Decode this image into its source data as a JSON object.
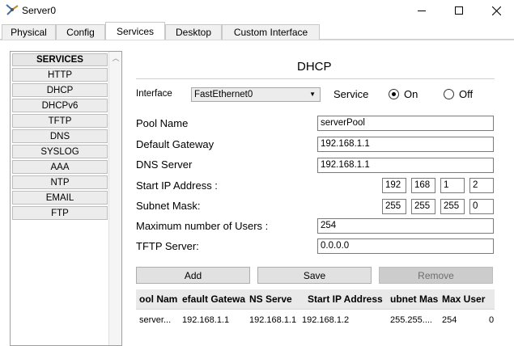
{
  "window": {
    "title": "Server0",
    "minimize": "—",
    "maximize": "☐",
    "close": "✕"
  },
  "tabs": [
    {
      "label": "Physical"
    },
    {
      "label": "Config"
    },
    {
      "label": "Services"
    },
    {
      "label": "Desktop"
    },
    {
      "label": "Custom Interface"
    }
  ],
  "services": {
    "header": "SERVICES",
    "items": [
      "HTTP",
      "DHCP",
      "DHCPv6",
      "TFTP",
      "DNS",
      "SYSLOG",
      "AAA",
      "NTP",
      "EMAIL",
      "FTP"
    ]
  },
  "dhcp": {
    "title": "DHCP",
    "interface_label": "Interface",
    "interface_value": "FastEthernet0",
    "service_label": "Service",
    "on_label": "On",
    "off_label": "Off",
    "service_state": "On",
    "pool_name_label": "Pool Name",
    "pool_name": "serverPool",
    "gateway_label": "Default Gateway",
    "gateway": "192.168.1.1",
    "dns_label": "DNS Server",
    "dns": "192.168.1.1",
    "start_ip_label": "Start IP Address :",
    "start_ip": [
      "192",
      "168",
      "1",
      "2"
    ],
    "subnet_label": "Subnet Mask:",
    "subnet": [
      "255",
      "255",
      "255",
      "0"
    ],
    "max_users_label": "Maximum number of Users :",
    "max_users": "254",
    "tftp_label": "TFTP Server:",
    "tftp": "0.0.0.0",
    "add_button": "Add",
    "save_button": "Save",
    "remove_button": "Remove"
  },
  "table": {
    "columns": [
      "ool Nam",
      "efault Gatewa",
      "NS Serve",
      "Start IP Address",
      "ubnet Mas",
      "Max User"
    ],
    "rows": [
      [
        "server...",
        "192.168.1.1",
        "192.168.1.1",
        "192.168.1.2",
        "255.255....",
        "254",
        "0"
      ]
    ]
  }
}
